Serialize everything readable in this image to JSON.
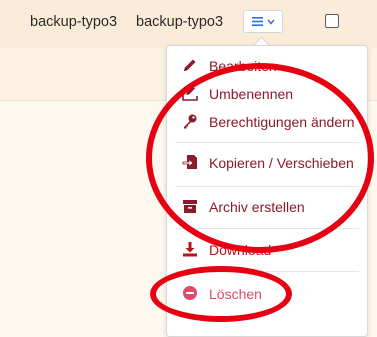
{
  "row": {
    "owner": "backup-typo3",
    "group": "backup-typo3"
  },
  "actions_button": {
    "icon": "menu-lines-icon",
    "chevron": "chevron-down-icon"
  },
  "menu": {
    "items": [
      {
        "label": "Bearbeiten",
        "icon": "pencil-icon"
      },
      {
        "label": "Umbenennen",
        "icon": "rename-icon"
      },
      {
        "label": "Berechtigungen ändern",
        "icon": "key-icon"
      },
      {
        "label": "Kopieren / Verschieben",
        "icon": "copy-move-icon"
      },
      {
        "label": "Archiv erstellen",
        "icon": "archive-icon"
      },
      {
        "label": "Download",
        "icon": "download-icon"
      },
      {
        "label": "Löschen",
        "icon": "minus-circle-icon"
      }
    ]
  },
  "colors": {
    "menu_text": "#8b1a2a",
    "delete_text": "#e2486a",
    "annotation_ring": "#e60012",
    "row_bg": "#fbebd9"
  }
}
